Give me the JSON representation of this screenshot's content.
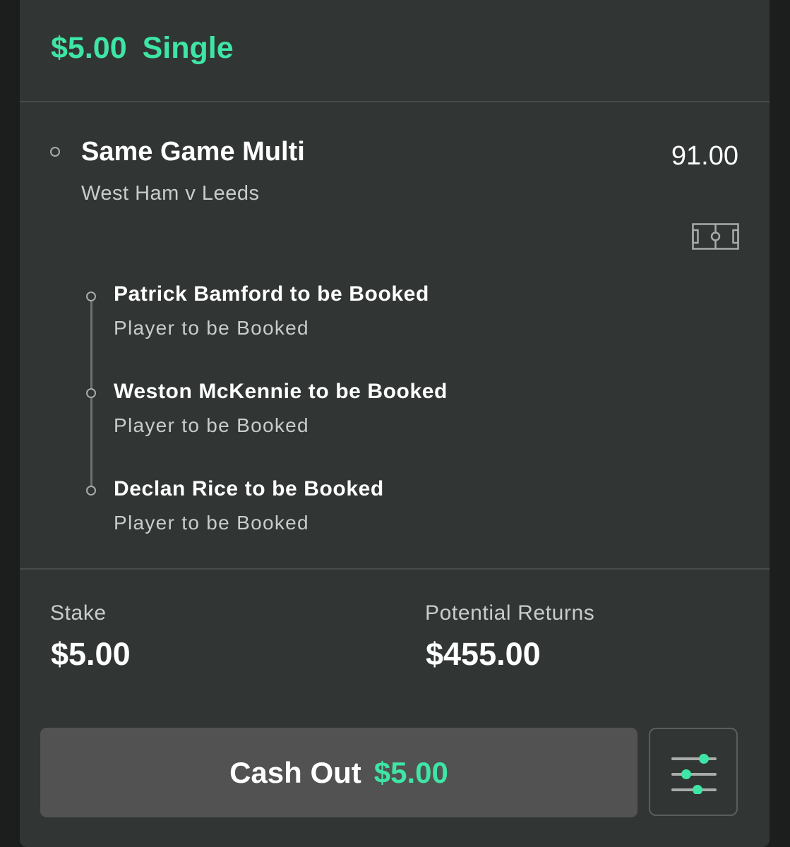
{
  "header": {
    "amount": "$5.00",
    "bet_type": "Single"
  },
  "bet": {
    "title": "Same Game Multi",
    "odds": "91.00",
    "event": "West Ham v Leeds",
    "event_icon": "football-pitch-icon",
    "legs": [
      {
        "title": "Patrick Bamford to be Booked",
        "market": "Player to be Booked"
      },
      {
        "title": "Weston McKennie to be Booked",
        "market": "Player to be Booked"
      },
      {
        "title": "Declan Rice to be Booked",
        "market": "Player to be Booked"
      }
    ]
  },
  "summary": {
    "stake_label": "Stake",
    "stake_value": "$5.00",
    "returns_label": "Potential Returns",
    "returns_value": "$455.00"
  },
  "actions": {
    "cashout_label": "Cash Out",
    "cashout_amount": "$5.00",
    "settings_icon": "sliders-icon"
  },
  "colors": {
    "accent": "#3ee5a5",
    "card_bg": "#313534",
    "button_bg": "#525252"
  }
}
